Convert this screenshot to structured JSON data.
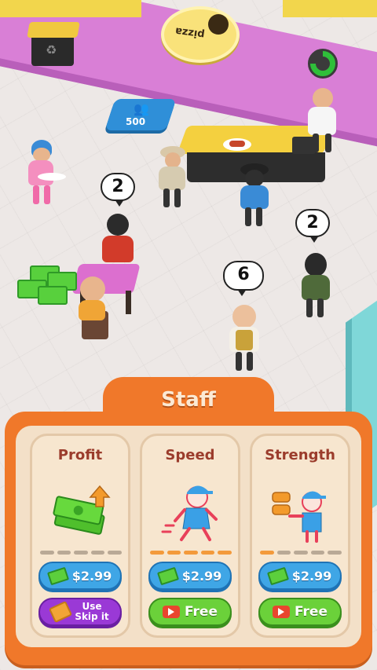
{
  "scene": {
    "bubbles": [
      "2",
      "2",
      "6"
    ],
    "upgrade_tile_cost": "500",
    "sign_text": "ɐzzᴉd",
    "timer_progress": 0.75
  },
  "panel": {
    "title": "Staff",
    "cards": [
      {
        "title": "Profit",
        "icon": "money-stack-arrow-up-icon",
        "progress": 0,
        "progress_total": 5,
        "buy_label": "$2.99",
        "alt_action": {
          "type": "skip-ticket",
          "label_line1": "Use",
          "label_line2": "Skip it"
        }
      },
      {
        "title": "Speed",
        "icon": "running-staff-icon",
        "progress": 5,
        "progress_total": 5,
        "buy_label": "$2.99",
        "alt_action": {
          "type": "video",
          "label": "Free"
        }
      },
      {
        "title": "Strength",
        "icon": "staff-carrying-trays-icon",
        "progress": 1,
        "progress_total": 5,
        "buy_label": "$2.99",
        "alt_action": {
          "type": "video",
          "label": "Free"
        }
      }
    ]
  },
  "colors": {
    "panel_orange": "#f0782a",
    "card_bg": "#f7e6cf",
    "buy_blue": "#3fa6e6",
    "free_green": "#6bd13a",
    "skip_purple": "#9a39d6",
    "progress_on": "#f39a3b",
    "progress_off": "#b9a996"
  }
}
